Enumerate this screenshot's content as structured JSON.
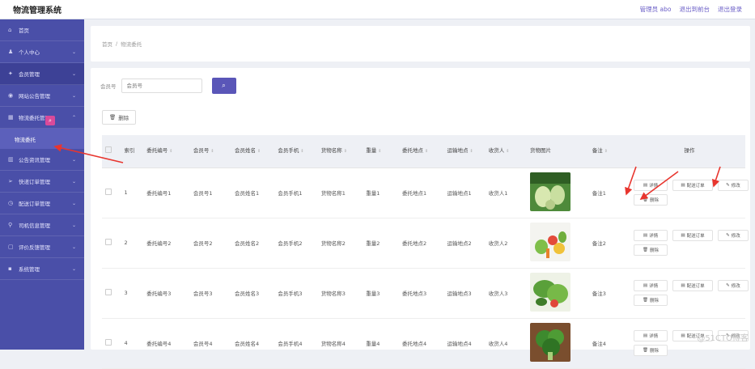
{
  "header": {
    "app_title": "物流管理系统",
    "links": [
      "管理员 abo",
      "退出到前台",
      "退出登录"
    ]
  },
  "sidebar": {
    "items": [
      {
        "label": "首页",
        "icon": "home-icon",
        "glyph": "⌂",
        "chevron": false
      },
      {
        "label": "个人中心",
        "icon": "user-icon",
        "glyph": "♟",
        "chevron": true
      },
      {
        "label": "会员管理",
        "icon": "member-icon",
        "glyph": "✦",
        "chevron": true,
        "active": true
      },
      {
        "label": "网站公告管理",
        "icon": "notice-icon",
        "glyph": "◉",
        "chevron": true
      },
      {
        "label": "物流委托管理",
        "icon": "grid-icon",
        "glyph": "▦",
        "chevron": true,
        "expanded": true
      },
      {
        "label": "公告资讯管理",
        "icon": "news-icon",
        "glyph": "▥",
        "chevron": true
      },
      {
        "label": "快递订单管理",
        "icon": "send-icon",
        "glyph": "➢",
        "chevron": true
      },
      {
        "label": "配送订单管理",
        "icon": "clock-icon",
        "glyph": "◷",
        "chevron": true
      },
      {
        "label": "司机信息管理",
        "icon": "pin-icon",
        "glyph": "⚲",
        "chevron": true
      },
      {
        "label": "评价反馈管理",
        "icon": "chat-icon",
        "glyph": "▢",
        "chevron": true
      },
      {
        "label": "系统管理",
        "icon": "settings-icon",
        "glyph": "▪",
        "chevron": true
      }
    ],
    "sub_item": "物流委托"
  },
  "breadcrumb": {
    "home": "首页",
    "sep": "/",
    "current": "物流委托"
  },
  "filter": {
    "label": "会员号",
    "placeholder": "会员号"
  },
  "delete_button": "删除",
  "table": {
    "headers": [
      "索引",
      "委托编号",
      "会员号",
      "会员姓名",
      "会员手机",
      "货物名称",
      "重量",
      "委托地点",
      "运输地点",
      "收货人",
      "货物图片",
      "备注",
      "操作"
    ],
    "rows": [
      {
        "index": "1",
        "code": "委托编号1",
        "member": "会员号1",
        "name": "会员姓名1",
        "phone": "会员手机1",
        "goods": "货物名称1",
        "weight": "重量1",
        "origin": "委托地点1",
        "dest": "运输地点1",
        "receiver": "收货人1",
        "note": "备注1",
        "img": "gourd"
      },
      {
        "index": "2",
        "code": "委托编号2",
        "member": "会员号2",
        "name": "会员姓名2",
        "phone": "会员手机2",
        "goods": "货物名称2",
        "weight": "重量2",
        "origin": "委托地点2",
        "dest": "运输地点2",
        "receiver": "收货人2",
        "note": "备注2",
        "img": "veg"
      },
      {
        "index": "3",
        "code": "委托编号3",
        "member": "会员号3",
        "name": "会员姓名3",
        "phone": "会员手机3",
        "goods": "货物名称3",
        "weight": "重量3",
        "origin": "委托地点3",
        "dest": "运输地点3",
        "receiver": "收货人3",
        "note": "备注3",
        "img": "greens"
      },
      {
        "index": "4",
        "code": "委托编号4",
        "member": "会员号4",
        "name": "会员姓名4",
        "phone": "会员手机4",
        "goods": "货物名称4",
        "weight": "重量4",
        "origin": "委托地点4",
        "dest": "运输地点4",
        "receiver": "收货人4",
        "note": "备注4",
        "img": "broccoli"
      }
    ],
    "ops": {
      "detail": "详情",
      "dispatch": "配送订单",
      "edit": "修改",
      "delete": "删除"
    }
  },
  "watermark": "@51CTO博客",
  "colors": {
    "sidebar": "#4a4fa8",
    "accent": "#5a56b8",
    "arrow": "#e8352e"
  }
}
